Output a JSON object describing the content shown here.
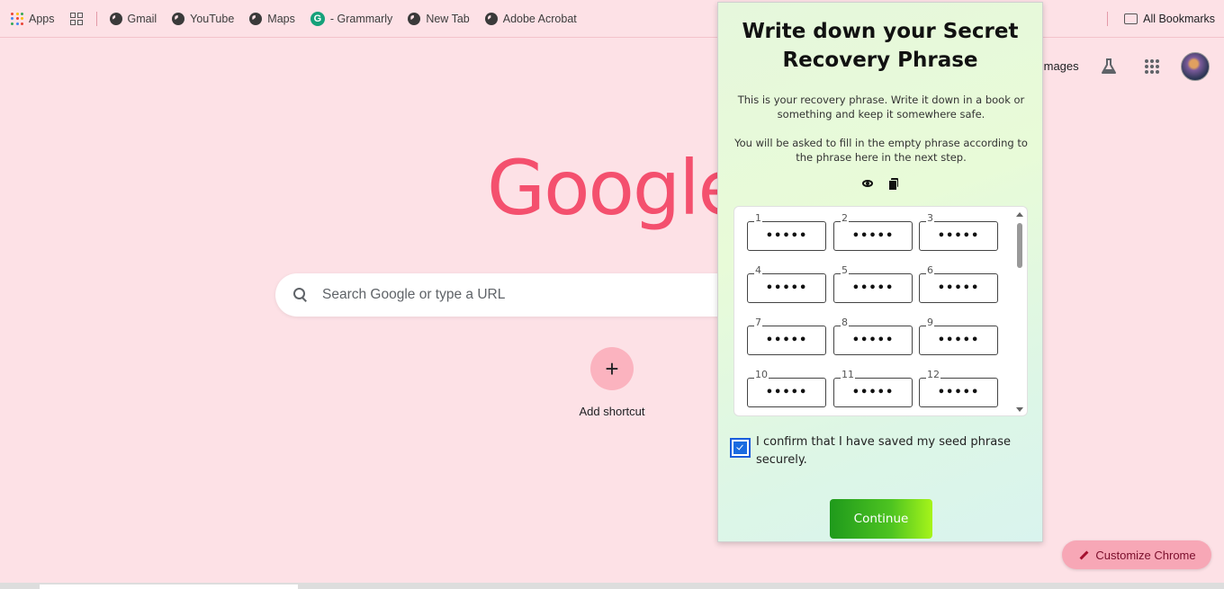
{
  "bookmarks": {
    "items": [
      {
        "label": "Apps",
        "icon": "apps-icon"
      },
      {
        "label": "",
        "icon": "grid-icon"
      },
      {
        "label": "Gmail",
        "icon": "globe-icon"
      },
      {
        "label": "YouTube",
        "icon": "globe-icon"
      },
      {
        "label": "Maps",
        "icon": "globe-icon"
      },
      {
        "label": "- Grammarly",
        "icon": "grammarly-icon"
      },
      {
        "label": "New Tab",
        "icon": "globe-icon"
      },
      {
        "label": "Adobe Acrobat",
        "icon": "globe-icon"
      }
    ],
    "all_bookmarks": "All Bookmarks"
  },
  "google": {
    "logo": "Google",
    "images_link": "Images",
    "search_placeholder": "Search Google or type a URL",
    "add_shortcut": "Add shortcut",
    "shortcut_symbol": "+",
    "customize": "Customize Chrome"
  },
  "popup": {
    "title": "Write down your Secret Recovery Phrase",
    "description_1": "This is your recovery phrase. Write it down in a book or something and keep it somewhere safe.",
    "description_2": "You will be asked to fill in the empty phrase according to the phrase here in the next step.",
    "words": [
      {
        "num": "1",
        "value": "•••••"
      },
      {
        "num": "2",
        "value": "•••••"
      },
      {
        "num": "3",
        "value": "•••••"
      },
      {
        "num": "4",
        "value": "•••••"
      },
      {
        "num": "5",
        "value": "•••••"
      },
      {
        "num": "6",
        "value": "•••••"
      },
      {
        "num": "7",
        "value": "•••••"
      },
      {
        "num": "8",
        "value": "•••••"
      },
      {
        "num": "9",
        "value": "•••••"
      },
      {
        "num": "10",
        "value": "•••••"
      },
      {
        "num": "11",
        "value": "•••••"
      },
      {
        "num": "12",
        "value": "•••••"
      }
    ],
    "confirm_text": "I confirm that I have saved my seed phrase securely.",
    "confirm_checked": true,
    "continue_label": "Continue"
  },
  "colors": {
    "page_background": "#fde1e6",
    "logo": "#f4506e",
    "checkbox": "#1a5cdc",
    "continue_gradient_start": "#1f9a1c",
    "continue_gradient_end": "#a6f41a"
  }
}
